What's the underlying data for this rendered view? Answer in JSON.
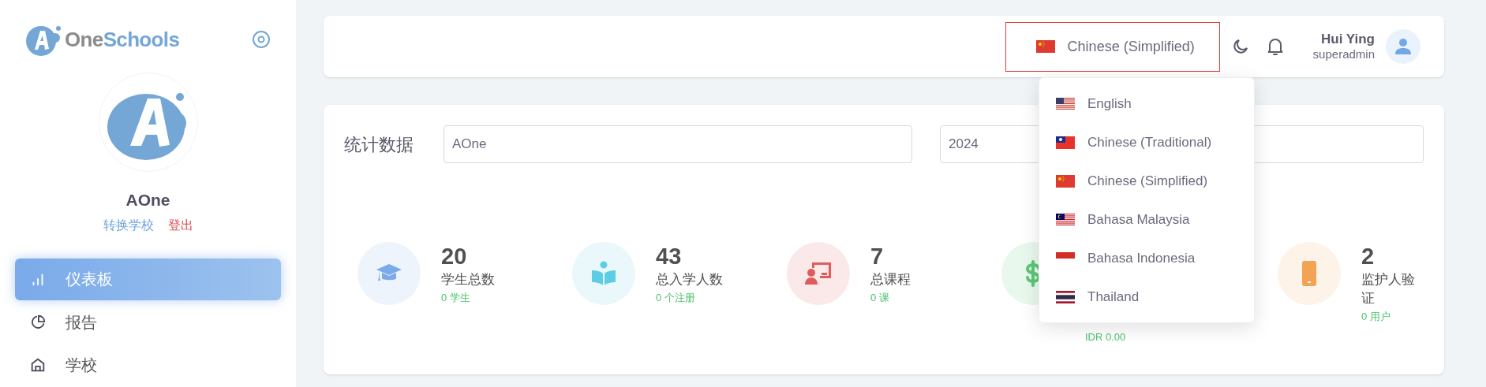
{
  "sidebar": {
    "brand": {
      "first": "One",
      "second": "Schools"
    },
    "school_name": "AOne",
    "links": [
      {
        "label": "转换学校",
        "kind": "switch"
      },
      {
        "label": "登出",
        "kind": "logout"
      }
    ],
    "items": [
      {
        "label": "仪表板",
        "kind": "chart",
        "selected": true
      },
      {
        "label": "报告",
        "kind": "pie",
        "selected": false
      },
      {
        "label": "学校",
        "kind": "home",
        "selected": false
      }
    ]
  },
  "header": {
    "language": {
      "label": "Chinese (Simplified)",
      "kind": "cn"
    },
    "user": {
      "name": "Hui Ying",
      "role": "superadmin"
    }
  },
  "language_menu": [
    {
      "label": "English",
      "kind": "us"
    },
    {
      "label": "Chinese (Traditional)",
      "kind": "tw"
    },
    {
      "label": "Chinese (Simplified)",
      "kind": "cn"
    },
    {
      "label": "Bahasa Malaysia",
      "kind": "my"
    },
    {
      "label": "Bahasa Indonesia",
      "kind": "id"
    },
    {
      "label": "Thailand",
      "kind": "th"
    }
  ],
  "stats": {
    "title": "统计数据",
    "school_field": {
      "value": "AOne"
    },
    "year_field": {
      "value": "2024"
    },
    "cards": [
      {
        "kind": "cap",
        "color": "#7aaaea",
        "value": "20",
        "label": "学生总数",
        "sub": "0 学生"
      },
      {
        "kind": "book",
        "color": "#5ecde4",
        "value": "43",
        "label": "总入学人数",
        "sub": "0 个注册"
      },
      {
        "kind": "board",
        "color": "#e05c5c",
        "value": "7",
        "label": "总课程",
        "sub": "0 课"
      },
      {
        "kind": "dollar",
        "color": "#5cc776",
        "sub": "IDR 0.00"
      },
      {
        "kind": "phone",
        "color": "#f2a354",
        "value": "2",
        "label": "监护人验证",
        "sub": "0 用户"
      }
    ]
  }
}
